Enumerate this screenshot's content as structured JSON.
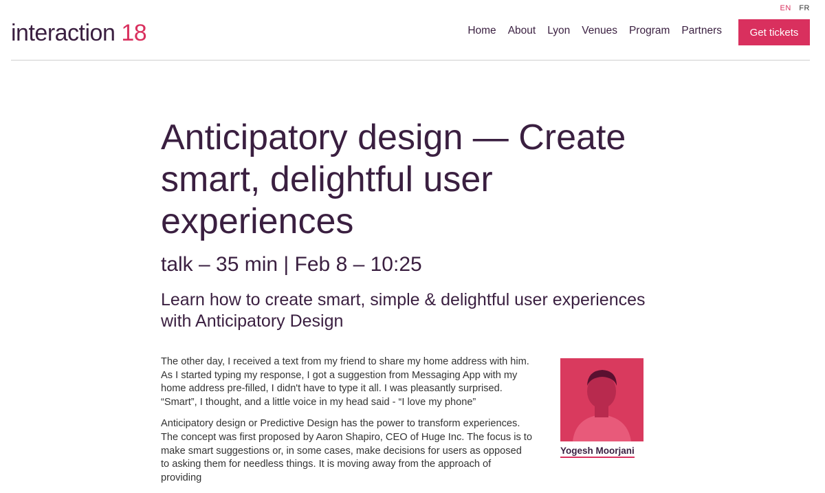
{
  "language": {
    "active": "EN",
    "other": "FR"
  },
  "header": {
    "logo": {
      "text": "interaction",
      "number": "18"
    },
    "nav": [
      "Home",
      "About",
      "Lyon",
      "Venues",
      "Program",
      "Partners"
    ],
    "cta_label": "Get tickets"
  },
  "colors": {
    "brand_purple": "#3a1f40",
    "accent": "#d9305e"
  },
  "talk": {
    "title": "Anticipatory design — Create smart, delightful user experiences",
    "meta": "talk – 35 min | Feb 8 – 10:25",
    "subtitle": "Learn how to create smart, simple & delightful user experiences with Anticipatory Design",
    "paragraphs": [
      "The other day, I received a text from my friend to share my home address with him. As I started typing my response, I got a suggestion from Messaging App with my home address pre-filled, I didn't have to type it all. I was pleasantly surprised. “Smart”, I thought, and a little voice in my head said - “I love my phone”",
      "Anticipatory design or Predictive Design has the power to transform experiences. The concept was first proposed by Aaron Shapiro, CEO of Huge Inc. The focus is to make smart suggestions or, in some cases, make decisions for users as opposed to asking them for needless things. It is moving away from the approach of providing"
    ]
  },
  "speaker": {
    "name": "Yogesh Moorjani"
  }
}
